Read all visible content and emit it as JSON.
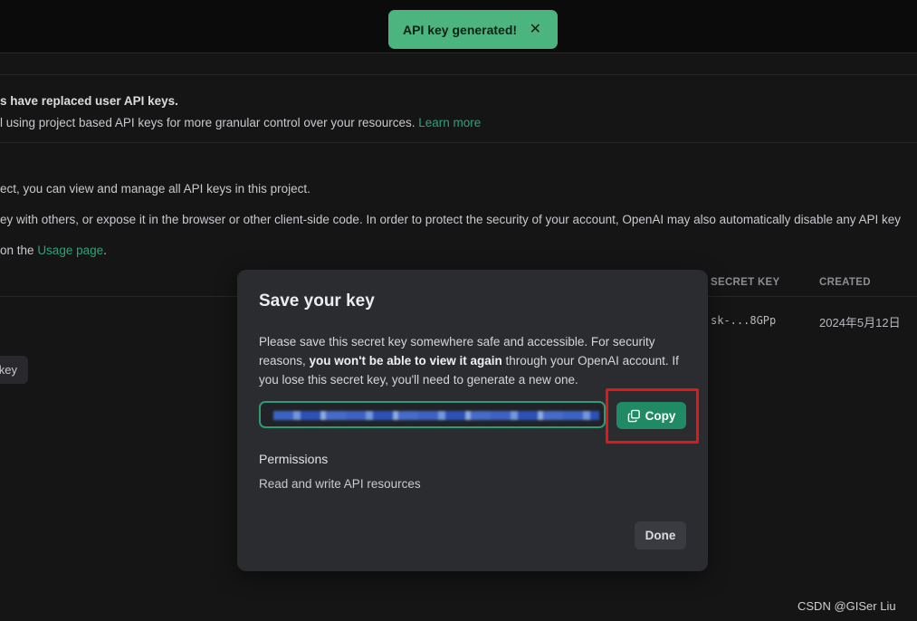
{
  "toast": {
    "message": "API key generated!",
    "close_glyph": "✕"
  },
  "notice": {
    "heading": "s have replaced user API keys.",
    "body": "l using project based API keys for more granular control over your resources.",
    "link": "Learn more"
  },
  "info": {
    "line1": "ect, you can view and manage all API keys in this project.",
    "line2": "ey with others, or expose it in the browser or other client-side code. In order to protect the security of your account, OpenAI may also automatically disable any API key",
    "line3_prefix": "on the",
    "line3_link": "Usage page",
    "line3_suffix": "."
  },
  "table": {
    "columns": [
      "SECRET KEY",
      "CREATED"
    ],
    "rows": [
      {
        "secret_key": "sk-...8GPp",
        "created": "2024年5月12日"
      }
    ]
  },
  "background_button": {
    "label": "key"
  },
  "modal": {
    "title": "Save your key",
    "desc_part1": "Please save this secret key somewhere safe and accessible. For security reasons, ",
    "desc_bold": "you won't be able to view it again",
    "desc_part2": " through your OpenAI account. If you lose this secret key, you'll need to generate a new one.",
    "copy_label": "Copy",
    "permissions_heading": "Permissions",
    "permissions_value": "Read and write API resources",
    "done_label": "Done"
  },
  "watermark": "CSDN @GISer Liu",
  "colors": {
    "accent": "#1f8a63",
    "toast": "#4cb57f",
    "highlight": "#e3161a"
  }
}
